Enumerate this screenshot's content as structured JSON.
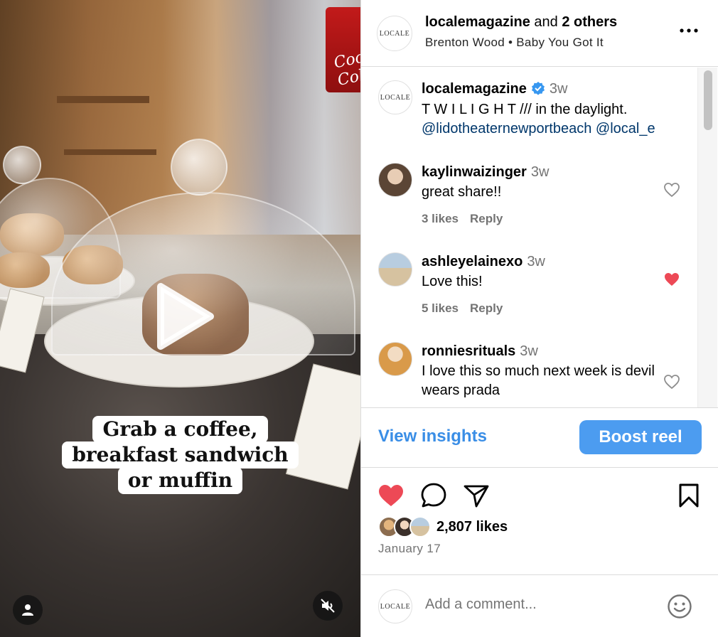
{
  "video": {
    "caption_lines": [
      "Grab a coffee,",
      "breakfast sandwich",
      "or muffin"
    ],
    "sign_brand": "Coca-Cola"
  },
  "header": {
    "account": "localemagazine",
    "others_prefix": "and",
    "others": "2 others",
    "artist": "Brenton Wood",
    "separator": "•",
    "song": "Baby You Got It",
    "avatar_text": "LOCALE"
  },
  "caption_comment": {
    "user": "localemagazine",
    "time": "3w",
    "text": "T W I L I G H T /// in the daylight.",
    "mentions": "@lidotheaternewportbeach @local_e",
    "avatar_text": "LOCALE"
  },
  "comments": [
    {
      "user": "kaylinwaizinger",
      "time": "3w",
      "text": "great share!!",
      "likes": "3 likes",
      "reply": "Reply",
      "liked": false,
      "avatar_color": "#8a6a55"
    },
    {
      "user": "ashleyelainexo",
      "time": "3w",
      "text": "Love this!",
      "likes": "5 likes",
      "reply": "Reply",
      "liked": true,
      "avatar_color": "#9fb6c9"
    },
    {
      "user": "ronniesrituals",
      "time": "3w",
      "text": "I love this so much next week is devil wears prada",
      "liked": false,
      "avatar_color": "#d99a4a"
    }
  ],
  "insights": {
    "view_label": "View insights",
    "boost_label": "Boost reel"
  },
  "post": {
    "likes": "2,807 likes",
    "date": "January 17"
  },
  "add_comment": {
    "placeholder": "Add a comment...",
    "avatar_text": "LOCALE"
  },
  "colors": {
    "accent_blue": "#4c9cf0",
    "like_red": "#ed4956",
    "link_navy": "#00376b"
  }
}
